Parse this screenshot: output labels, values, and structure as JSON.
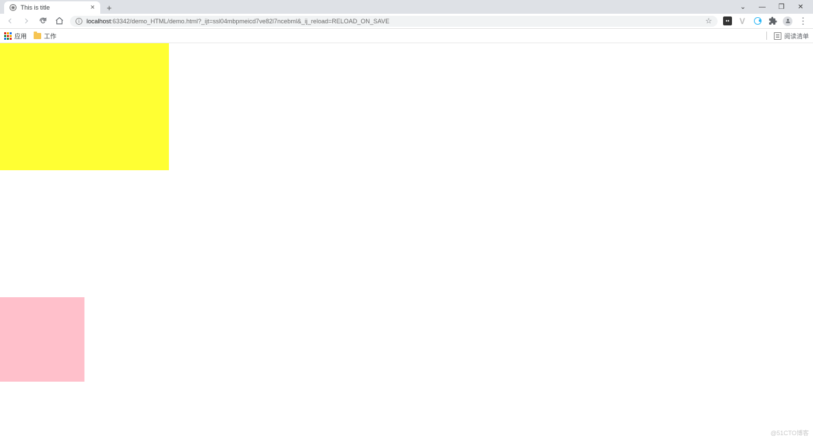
{
  "tab": {
    "title": "This is title",
    "close": "×",
    "new_tab": "+"
  },
  "window_controls": {
    "dropdown": "⌄",
    "minimize": "—",
    "maximize": "❐",
    "close": "✕"
  },
  "address_bar": {
    "info_icon": "i",
    "host": "localhost",
    "port_path": ":63342/demo_HTML/demo.html?_ijt=ssl04mbpmeicd7ve82l7ncebml&_ij_reload=RELOAD_ON_SAVE",
    "star": "☆"
  },
  "extensions": {
    "face": "••",
    "v": "V",
    "menu_dots": "⋮"
  },
  "bookmarks": {
    "apps_label": "应用",
    "folder_work": "工作",
    "reading_list": "阅读清单"
  },
  "page": {
    "yellow_box_color": "#ffff33",
    "pink_box_color": "#ffc0cb"
  },
  "watermark": "@51CTO博客"
}
